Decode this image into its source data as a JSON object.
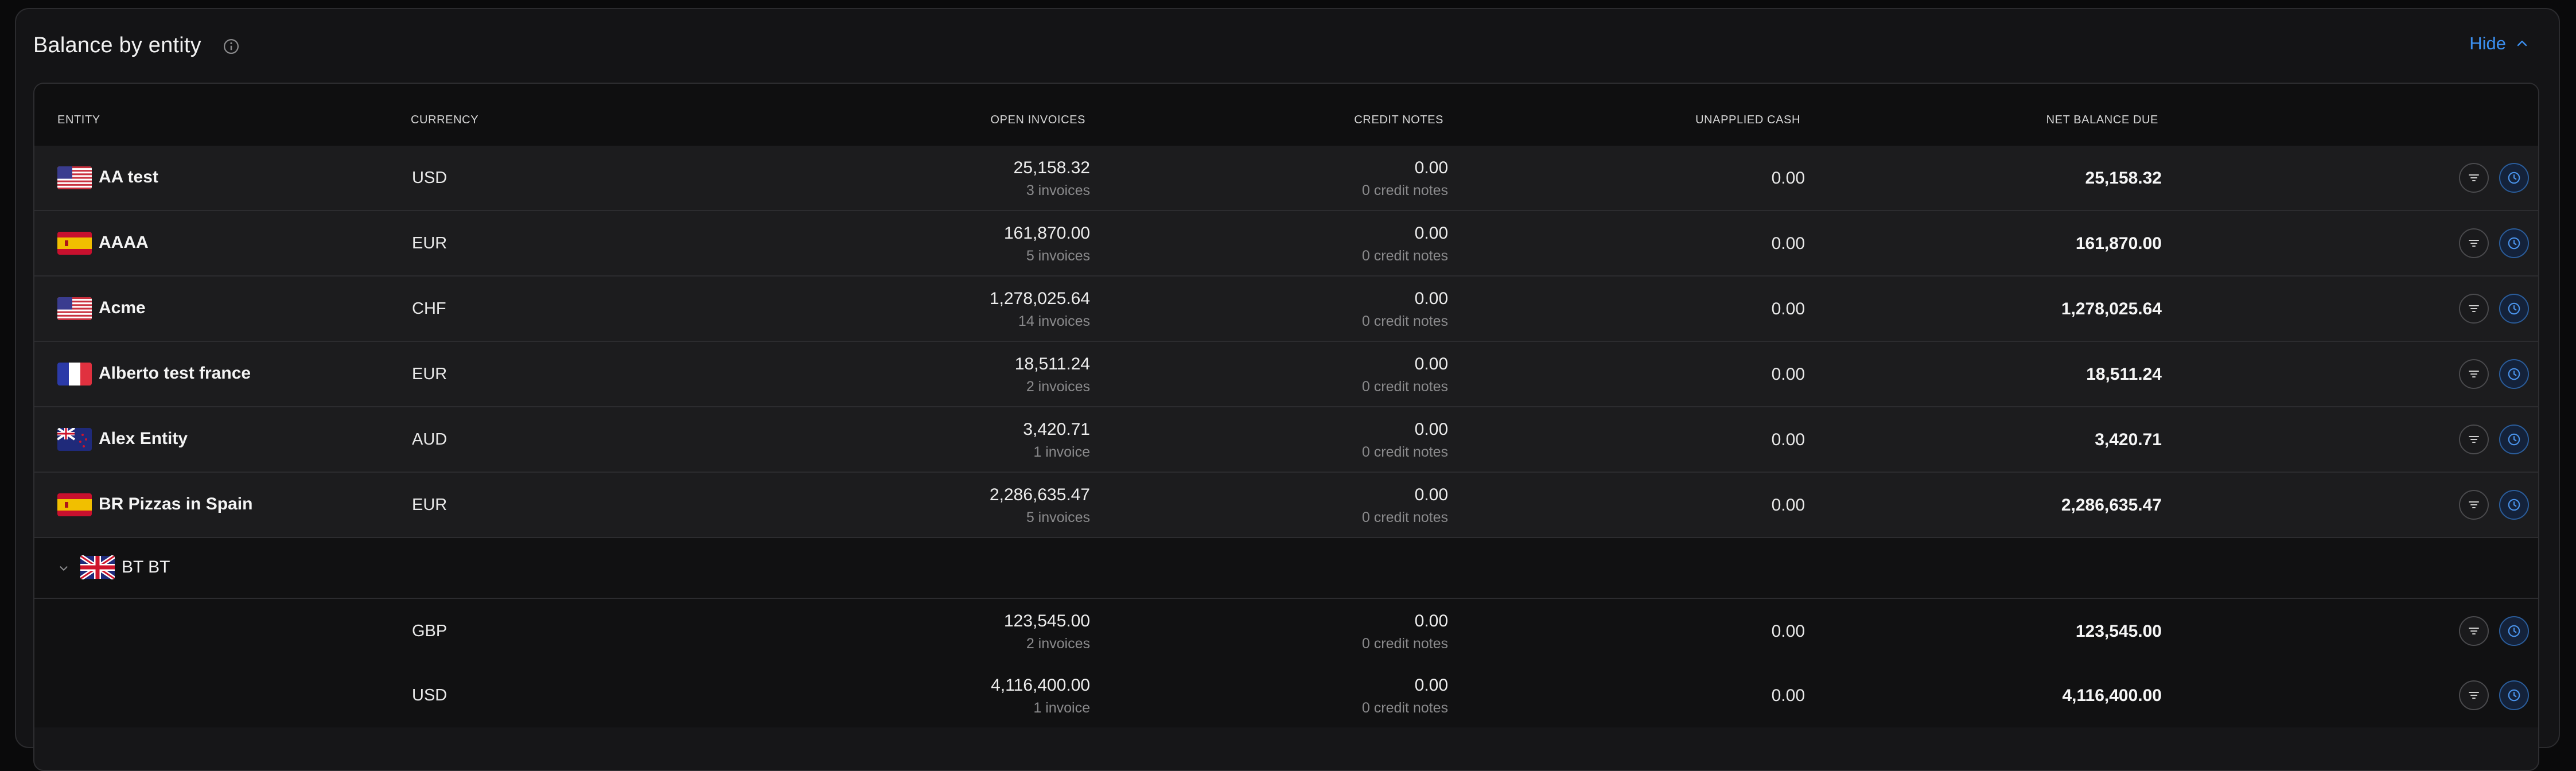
{
  "panel": {
    "title": "Balance by entity",
    "hide_label": "Hide"
  },
  "table": {
    "headers": {
      "entity": "ENTITY",
      "currency": "CURRENCY",
      "open_invoices": "OPEN INVOICES",
      "credit_notes": "CREDIT NOTES",
      "unapplied_cash": "UNAPPLIED CASH",
      "net_balance_due": "NET BALANCE DUE"
    },
    "rows": [
      {
        "entity": "AA test",
        "flag": "us-flag-icon",
        "currency": "USD",
        "open_invoices": "25,158.32",
        "invoice_count": "3 invoices",
        "credit_notes": "0.00",
        "credit_count": "0 credit notes",
        "unapplied_cash": "0.00",
        "net_balance_due": "25,158.32"
      },
      {
        "entity": "AAAA",
        "flag": "es-flag-icon",
        "currency": "EUR",
        "open_invoices": "161,870.00",
        "invoice_count": "5 invoices",
        "credit_notes": "0.00",
        "credit_count": "0 credit notes",
        "unapplied_cash": "0.00",
        "net_balance_due": "161,870.00"
      },
      {
        "entity": "Acme",
        "flag": "us-flag-icon",
        "currency": "CHF",
        "open_invoices": "1,278,025.64",
        "invoice_count": "14 invoices",
        "credit_notes": "0.00",
        "credit_count": "0 credit notes",
        "unapplied_cash": "0.00",
        "net_balance_due": "1,278,025.64"
      },
      {
        "entity": "Alberto test france",
        "flag": "fr-flag-icon",
        "currency": "EUR",
        "open_invoices": "18,511.24",
        "invoice_count": "2 invoices",
        "credit_notes": "0.00",
        "credit_count": "0 credit notes",
        "unapplied_cash": "0.00",
        "net_balance_due": "18,511.24"
      },
      {
        "entity": "Alex Entity",
        "flag": "nz-flag-icon",
        "currency": "AUD",
        "open_invoices": "3,420.71",
        "invoice_count": "1 invoice",
        "credit_notes": "0.00",
        "credit_count": "0 credit notes",
        "unapplied_cash": "0.00",
        "net_balance_due": "3,420.71"
      },
      {
        "entity": "BR Pizzas in Spain",
        "flag": "es-flag-icon",
        "currency": "EUR",
        "open_invoices": "2,286,635.47",
        "invoice_count": "5 invoices",
        "credit_notes": "0.00",
        "credit_count": "0 credit notes",
        "unapplied_cash": "0.00",
        "net_balance_due": "2,286,635.47"
      }
    ],
    "group": {
      "entity": "BT BT",
      "flag": "uk-flag-icon",
      "expanded": true,
      "rows": [
        {
          "currency": "GBP",
          "open_invoices": "123,545.00",
          "invoice_count": "2 invoices",
          "credit_notes": "0.00",
          "credit_count": "0 credit notes",
          "unapplied_cash": "0.00",
          "net_balance_due": "123,545.00"
        },
        {
          "currency": "USD",
          "open_invoices": "4,116,400.00",
          "invoice_count": "1 invoice",
          "credit_notes": "0.00",
          "credit_count": "0 credit notes",
          "unapplied_cash": "0.00",
          "net_balance_due": "4,116,400.00"
        }
      ]
    }
  },
  "colors": {
    "accent": "#3b8ff0",
    "background": "#0a0a0b",
    "panel": "#141416",
    "row": "#1c1c1e",
    "muted_text": "#8a8a8c"
  }
}
